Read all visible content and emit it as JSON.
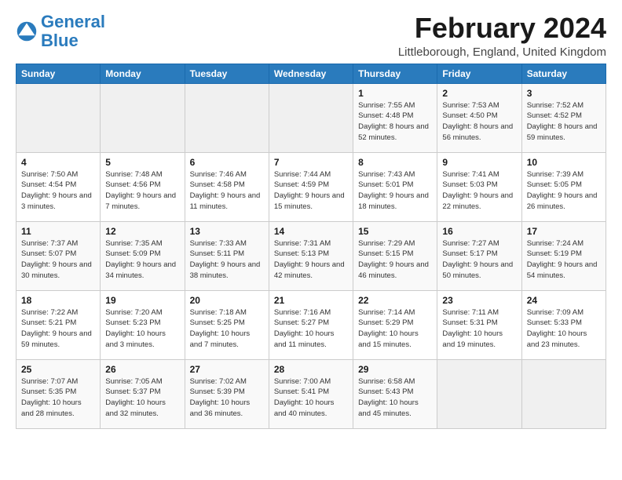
{
  "header": {
    "logo_general": "General",
    "logo_blue": "Blue",
    "month_title": "February 2024",
    "location": "Littleborough, England, United Kingdom"
  },
  "calendar": {
    "days_of_week": [
      "Sunday",
      "Monday",
      "Tuesday",
      "Wednesday",
      "Thursday",
      "Friday",
      "Saturday"
    ],
    "weeks": [
      [
        {
          "day": "",
          "sunrise": "",
          "sunset": "",
          "daylight": "",
          "empty": true
        },
        {
          "day": "",
          "sunrise": "",
          "sunset": "",
          "daylight": "",
          "empty": true
        },
        {
          "day": "",
          "sunrise": "",
          "sunset": "",
          "daylight": "",
          "empty": true
        },
        {
          "day": "",
          "sunrise": "",
          "sunset": "",
          "daylight": "",
          "empty": true
        },
        {
          "day": "1",
          "sunrise": "Sunrise: 7:55 AM",
          "sunset": "Sunset: 4:48 PM",
          "daylight": "Daylight: 8 hours and 52 minutes."
        },
        {
          "day": "2",
          "sunrise": "Sunrise: 7:53 AM",
          "sunset": "Sunset: 4:50 PM",
          "daylight": "Daylight: 8 hours and 56 minutes."
        },
        {
          "day": "3",
          "sunrise": "Sunrise: 7:52 AM",
          "sunset": "Sunset: 4:52 PM",
          "daylight": "Daylight: 8 hours and 59 minutes."
        }
      ],
      [
        {
          "day": "4",
          "sunrise": "Sunrise: 7:50 AM",
          "sunset": "Sunset: 4:54 PM",
          "daylight": "Daylight: 9 hours and 3 minutes."
        },
        {
          "day": "5",
          "sunrise": "Sunrise: 7:48 AM",
          "sunset": "Sunset: 4:56 PM",
          "daylight": "Daylight: 9 hours and 7 minutes."
        },
        {
          "day": "6",
          "sunrise": "Sunrise: 7:46 AM",
          "sunset": "Sunset: 4:58 PM",
          "daylight": "Daylight: 9 hours and 11 minutes."
        },
        {
          "day": "7",
          "sunrise": "Sunrise: 7:44 AM",
          "sunset": "Sunset: 4:59 PM",
          "daylight": "Daylight: 9 hours and 15 minutes."
        },
        {
          "day": "8",
          "sunrise": "Sunrise: 7:43 AM",
          "sunset": "Sunset: 5:01 PM",
          "daylight": "Daylight: 9 hours and 18 minutes."
        },
        {
          "day": "9",
          "sunrise": "Sunrise: 7:41 AM",
          "sunset": "Sunset: 5:03 PM",
          "daylight": "Daylight: 9 hours and 22 minutes."
        },
        {
          "day": "10",
          "sunrise": "Sunrise: 7:39 AM",
          "sunset": "Sunset: 5:05 PM",
          "daylight": "Daylight: 9 hours and 26 minutes."
        }
      ],
      [
        {
          "day": "11",
          "sunrise": "Sunrise: 7:37 AM",
          "sunset": "Sunset: 5:07 PM",
          "daylight": "Daylight: 9 hours and 30 minutes."
        },
        {
          "day": "12",
          "sunrise": "Sunrise: 7:35 AM",
          "sunset": "Sunset: 5:09 PM",
          "daylight": "Daylight: 9 hours and 34 minutes."
        },
        {
          "day": "13",
          "sunrise": "Sunrise: 7:33 AM",
          "sunset": "Sunset: 5:11 PM",
          "daylight": "Daylight: 9 hours and 38 minutes."
        },
        {
          "day": "14",
          "sunrise": "Sunrise: 7:31 AM",
          "sunset": "Sunset: 5:13 PM",
          "daylight": "Daylight: 9 hours and 42 minutes."
        },
        {
          "day": "15",
          "sunrise": "Sunrise: 7:29 AM",
          "sunset": "Sunset: 5:15 PM",
          "daylight": "Daylight: 9 hours and 46 minutes."
        },
        {
          "day": "16",
          "sunrise": "Sunrise: 7:27 AM",
          "sunset": "Sunset: 5:17 PM",
          "daylight": "Daylight: 9 hours and 50 minutes."
        },
        {
          "day": "17",
          "sunrise": "Sunrise: 7:24 AM",
          "sunset": "Sunset: 5:19 PM",
          "daylight": "Daylight: 9 hours and 54 minutes."
        }
      ],
      [
        {
          "day": "18",
          "sunrise": "Sunrise: 7:22 AM",
          "sunset": "Sunset: 5:21 PM",
          "daylight": "Daylight: 9 hours and 59 minutes."
        },
        {
          "day": "19",
          "sunrise": "Sunrise: 7:20 AM",
          "sunset": "Sunset: 5:23 PM",
          "daylight": "Daylight: 10 hours and 3 minutes."
        },
        {
          "day": "20",
          "sunrise": "Sunrise: 7:18 AM",
          "sunset": "Sunset: 5:25 PM",
          "daylight": "Daylight: 10 hours and 7 minutes."
        },
        {
          "day": "21",
          "sunrise": "Sunrise: 7:16 AM",
          "sunset": "Sunset: 5:27 PM",
          "daylight": "Daylight: 10 hours and 11 minutes."
        },
        {
          "day": "22",
          "sunrise": "Sunrise: 7:14 AM",
          "sunset": "Sunset: 5:29 PM",
          "daylight": "Daylight: 10 hours and 15 minutes."
        },
        {
          "day": "23",
          "sunrise": "Sunrise: 7:11 AM",
          "sunset": "Sunset: 5:31 PM",
          "daylight": "Daylight: 10 hours and 19 minutes."
        },
        {
          "day": "24",
          "sunrise": "Sunrise: 7:09 AM",
          "sunset": "Sunset: 5:33 PM",
          "daylight": "Daylight: 10 hours and 23 minutes."
        }
      ],
      [
        {
          "day": "25",
          "sunrise": "Sunrise: 7:07 AM",
          "sunset": "Sunset: 5:35 PM",
          "daylight": "Daylight: 10 hours and 28 minutes."
        },
        {
          "day": "26",
          "sunrise": "Sunrise: 7:05 AM",
          "sunset": "Sunset: 5:37 PM",
          "daylight": "Daylight: 10 hours and 32 minutes."
        },
        {
          "day": "27",
          "sunrise": "Sunrise: 7:02 AM",
          "sunset": "Sunset: 5:39 PM",
          "daylight": "Daylight: 10 hours and 36 minutes."
        },
        {
          "day": "28",
          "sunrise": "Sunrise: 7:00 AM",
          "sunset": "Sunset: 5:41 PM",
          "daylight": "Daylight: 10 hours and 40 minutes."
        },
        {
          "day": "29",
          "sunrise": "Sunrise: 6:58 AM",
          "sunset": "Sunset: 5:43 PM",
          "daylight": "Daylight: 10 hours and 45 minutes."
        },
        {
          "day": "",
          "sunrise": "",
          "sunset": "",
          "daylight": "",
          "empty": true
        },
        {
          "day": "",
          "sunrise": "",
          "sunset": "",
          "daylight": "",
          "empty": true
        }
      ]
    ]
  }
}
